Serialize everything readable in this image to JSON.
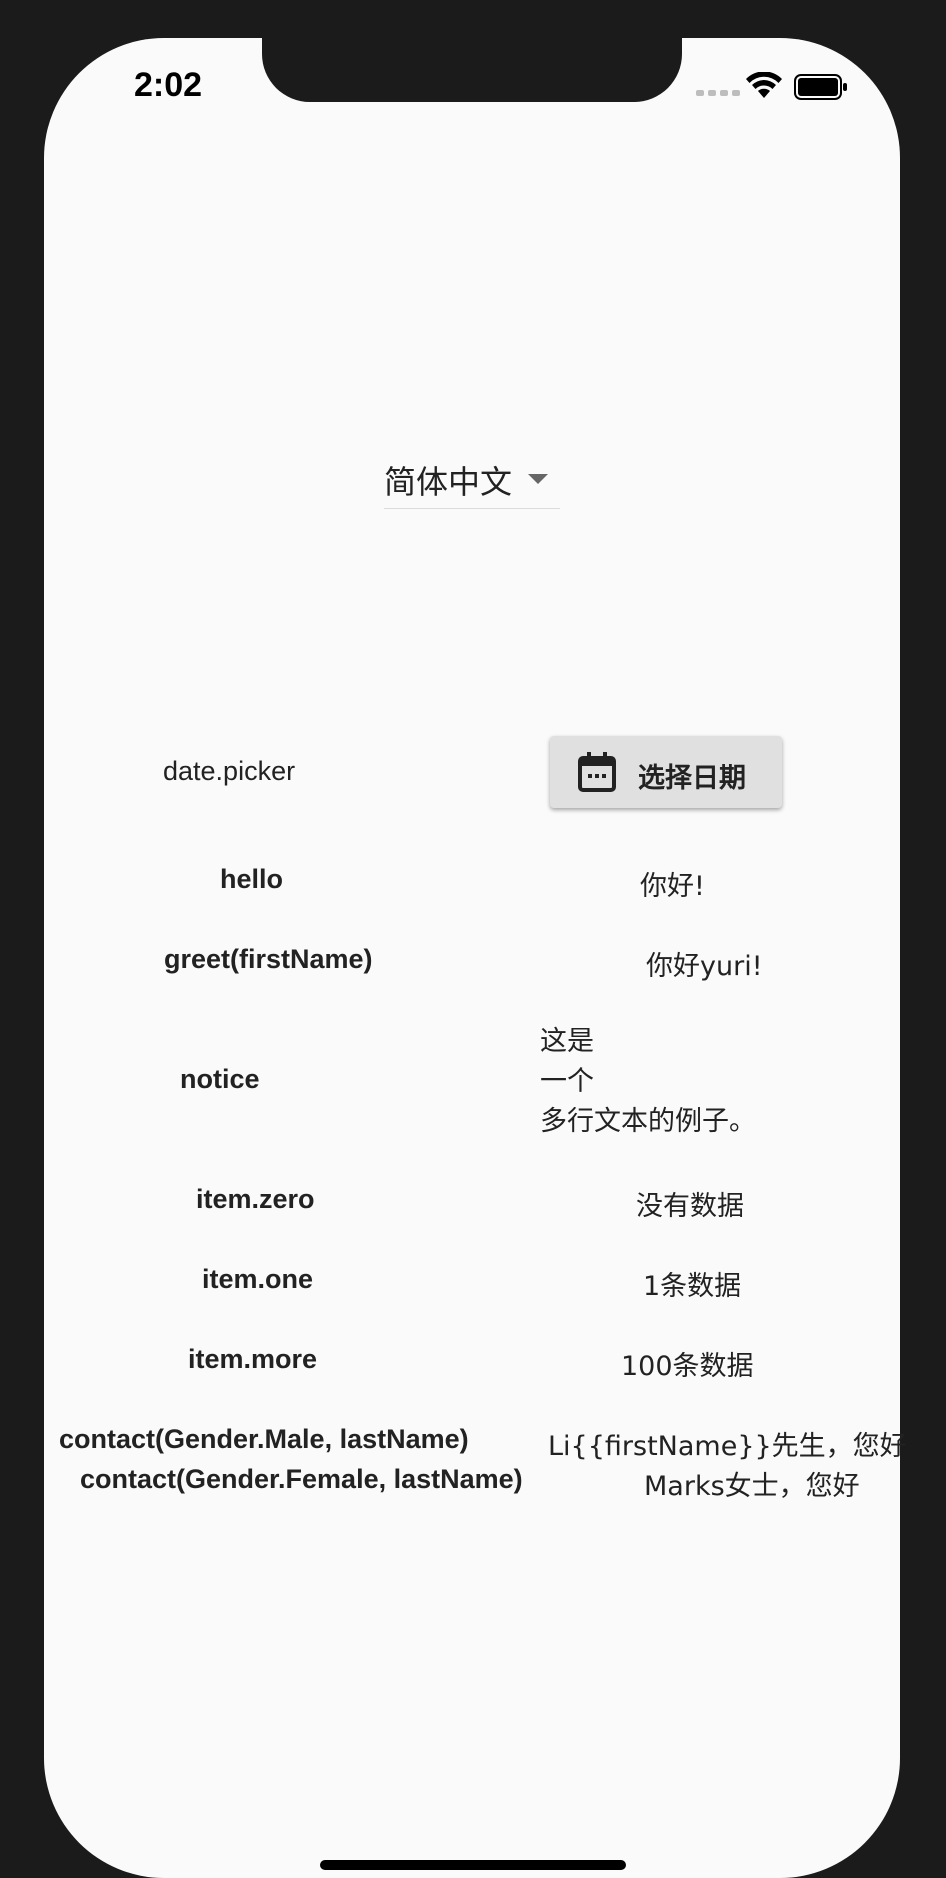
{
  "status_bar": {
    "time": "2:02"
  },
  "language_select": {
    "value": "简体中文"
  },
  "rows": {
    "date": {
      "key": "date.picker",
      "button_label": "选择日期"
    },
    "hello": {
      "key": "hello",
      "value": "你好!"
    },
    "greet": {
      "key": "greet(firstName)",
      "value": "你好yuri!"
    },
    "notice": {
      "key": "notice",
      "lines": [
        "这是",
        "一个",
        "多行文本的例子。"
      ]
    },
    "item_zero": {
      "key": "item.zero",
      "value": "没有数据"
    },
    "item_one": {
      "key": "item.one",
      "value": "1条数据"
    },
    "item_more": {
      "key": "item.more",
      "value": "100条数据"
    },
    "contact_male": {
      "key": "contact(Gender.Male, lastName)",
      "value": "Li{{firstName}}先生，您好"
    },
    "contact_female": {
      "key": "contact(Gender.Female, lastName)",
      "value": "Marks女士，您好"
    }
  },
  "icons": {
    "calendar": "calendar-icon",
    "dropdown": "dropdown-caret-icon"
  }
}
